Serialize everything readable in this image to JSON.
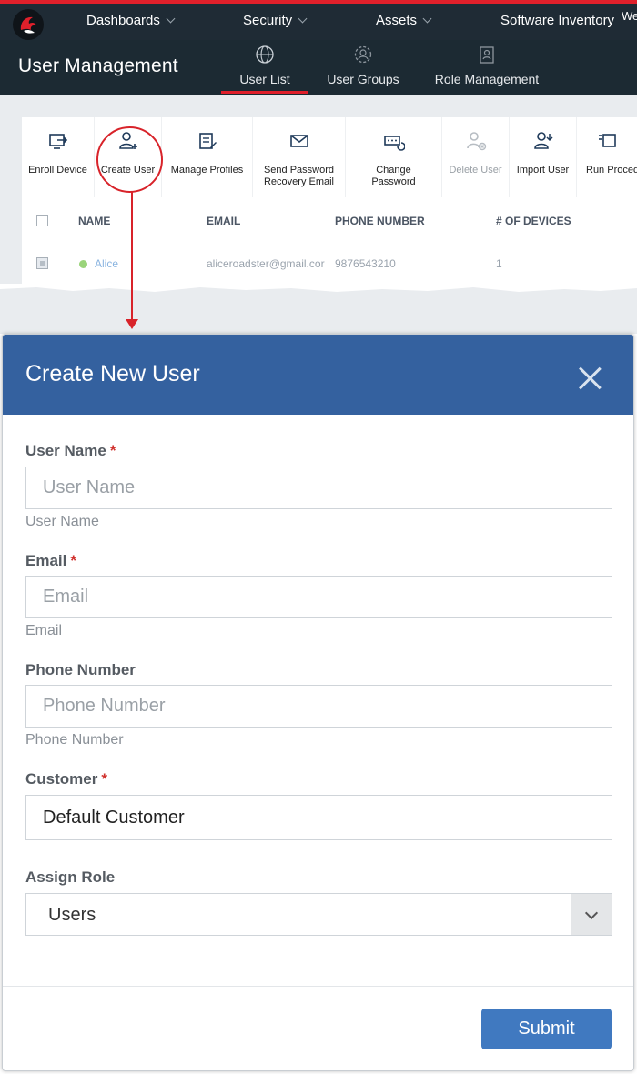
{
  "topnav": {
    "items": [
      "Dashboards",
      "Security",
      "Assets",
      "Software Inventory"
    ],
    "corner_text": "We"
  },
  "subheader": {
    "title": "User Management",
    "tabs": [
      "User List",
      "User Groups",
      "Role Management"
    ],
    "active_tab": "User List"
  },
  "toolbar": {
    "enroll_device": "Enroll Device",
    "create_user": "Create User",
    "manage_profiles": "Manage Profiles",
    "send_password": "Send Password",
    "recovery_email": "Recovery Email",
    "change": "Change",
    "password": "Password",
    "delete_user": "Delete User",
    "import_user": "Import User",
    "run_procedure": "Run Proced"
  },
  "table": {
    "headers": [
      "NAME",
      "EMAIL",
      "PHONE NUMBER",
      "# OF DEVICES"
    ],
    "rows": [
      {
        "name": "Alice",
        "email": "aliceroadster@gmail.cor",
        "phone": "9876543210",
        "devices": "1"
      }
    ]
  },
  "modal": {
    "title": "Create New User",
    "fields": {
      "username": {
        "label": "User Name",
        "required": "*",
        "placeholder": "User Name",
        "hint": "User Name"
      },
      "email": {
        "label": "Email",
        "required": "*",
        "placeholder": "Email",
        "hint": "Email"
      },
      "phone": {
        "label": "Phone Number",
        "placeholder": "Phone Number",
        "hint": "Phone Number"
      },
      "customer": {
        "label": "Customer",
        "required": "*",
        "value": "Default Customer"
      },
      "role": {
        "label": "Assign Role",
        "value": "Users"
      }
    },
    "submit_label": "Submit"
  },
  "colors": {
    "topnav_bg": "#1f2b35",
    "accent_red": "#e0202b",
    "modal_header": "#34619f",
    "submit_button": "#4079c0"
  }
}
